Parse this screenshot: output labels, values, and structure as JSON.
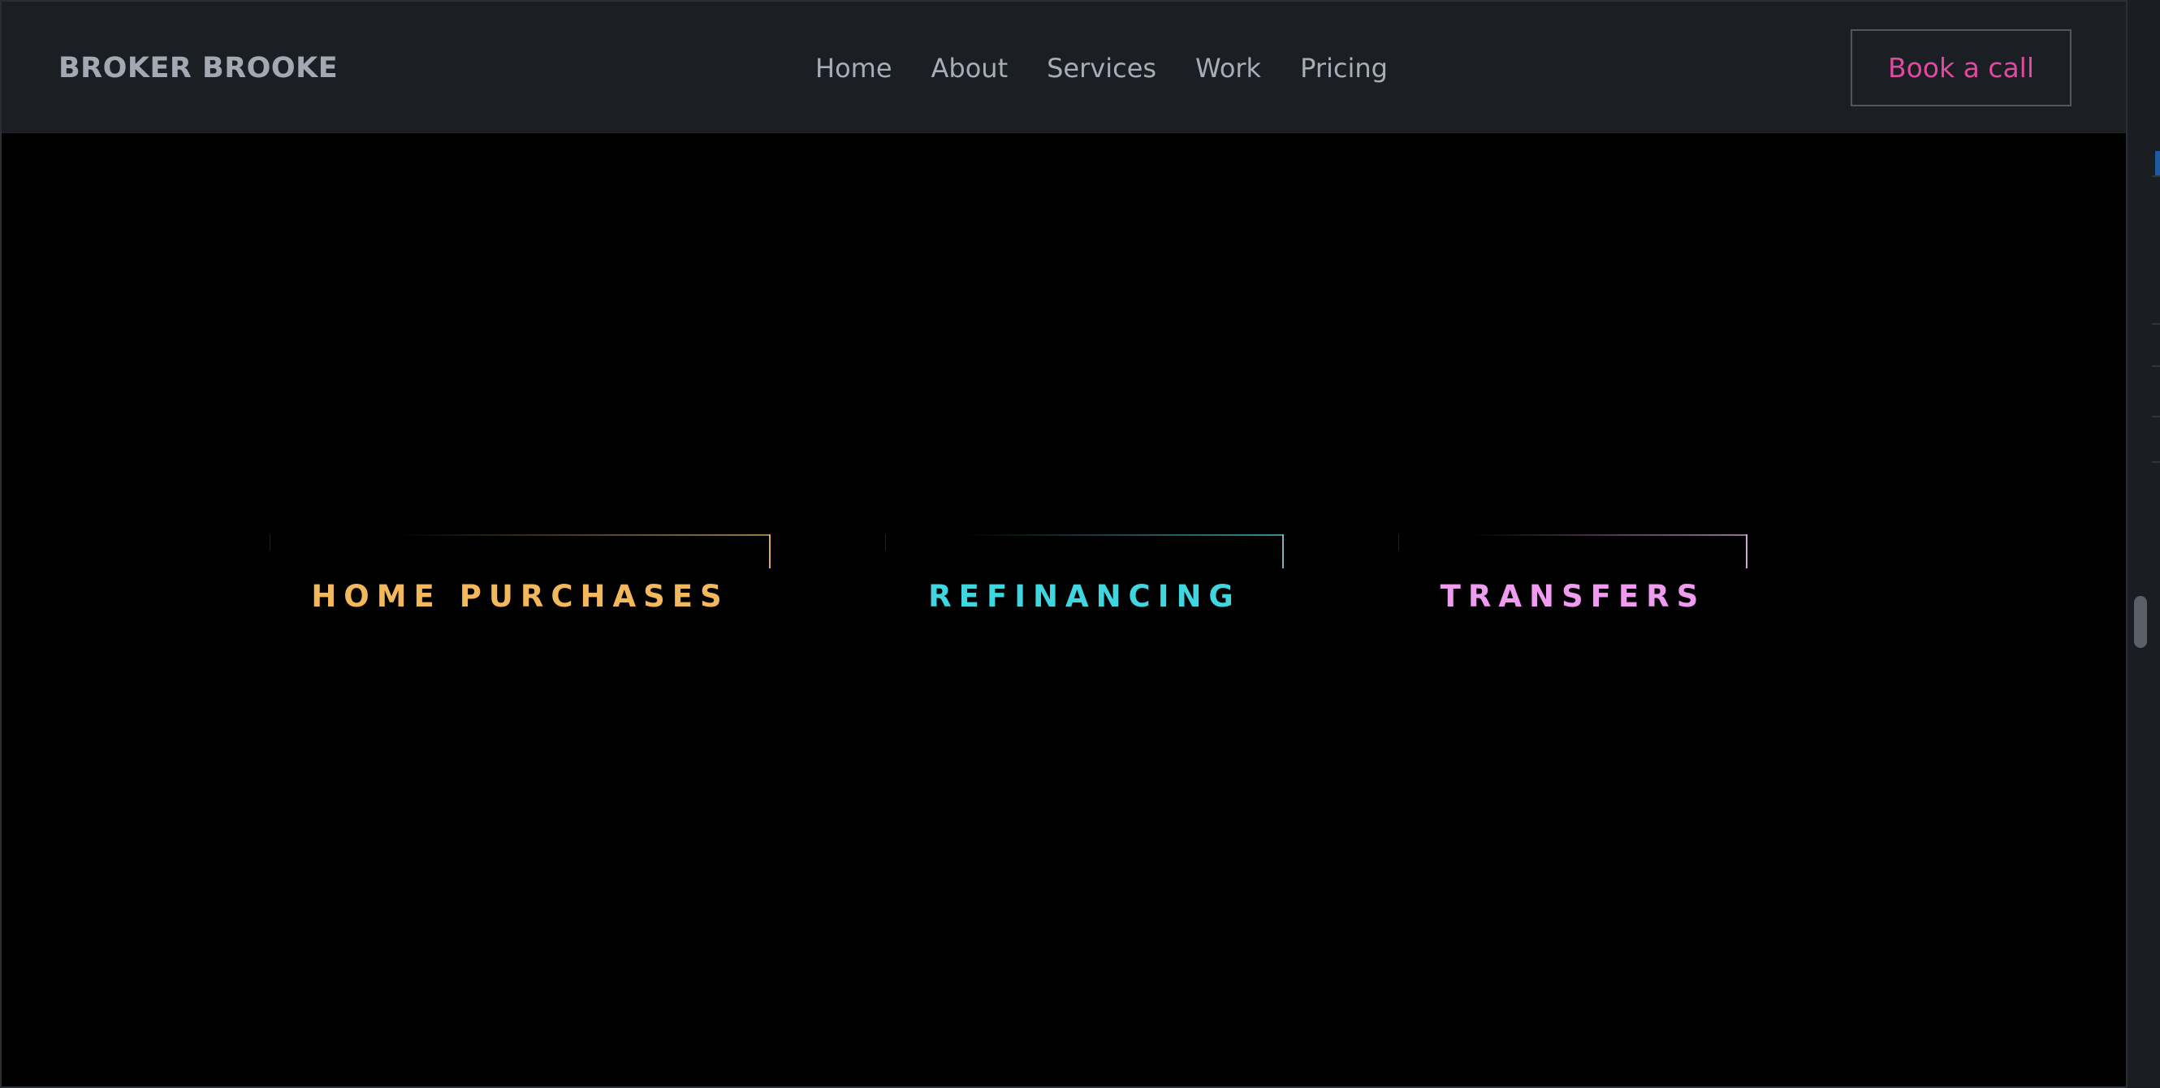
{
  "header": {
    "brand": "BROKER BROOKE",
    "nav": [
      "Home",
      "About",
      "Services",
      "Work",
      "Pricing"
    ],
    "cta_label": "Book a call"
  },
  "services": [
    {
      "title": "HOME PURCHASES",
      "color": "#f3b85c"
    },
    {
      "title": "REFINANCING",
      "color": "#3fd6e0"
    },
    {
      "title": "TRANSFERS",
      "color": "#ee9bf0"
    }
  ],
  "colors": {
    "page_background": "#000000",
    "navbar_background": "#1b1f24",
    "cta_text": "#e0499f"
  }
}
